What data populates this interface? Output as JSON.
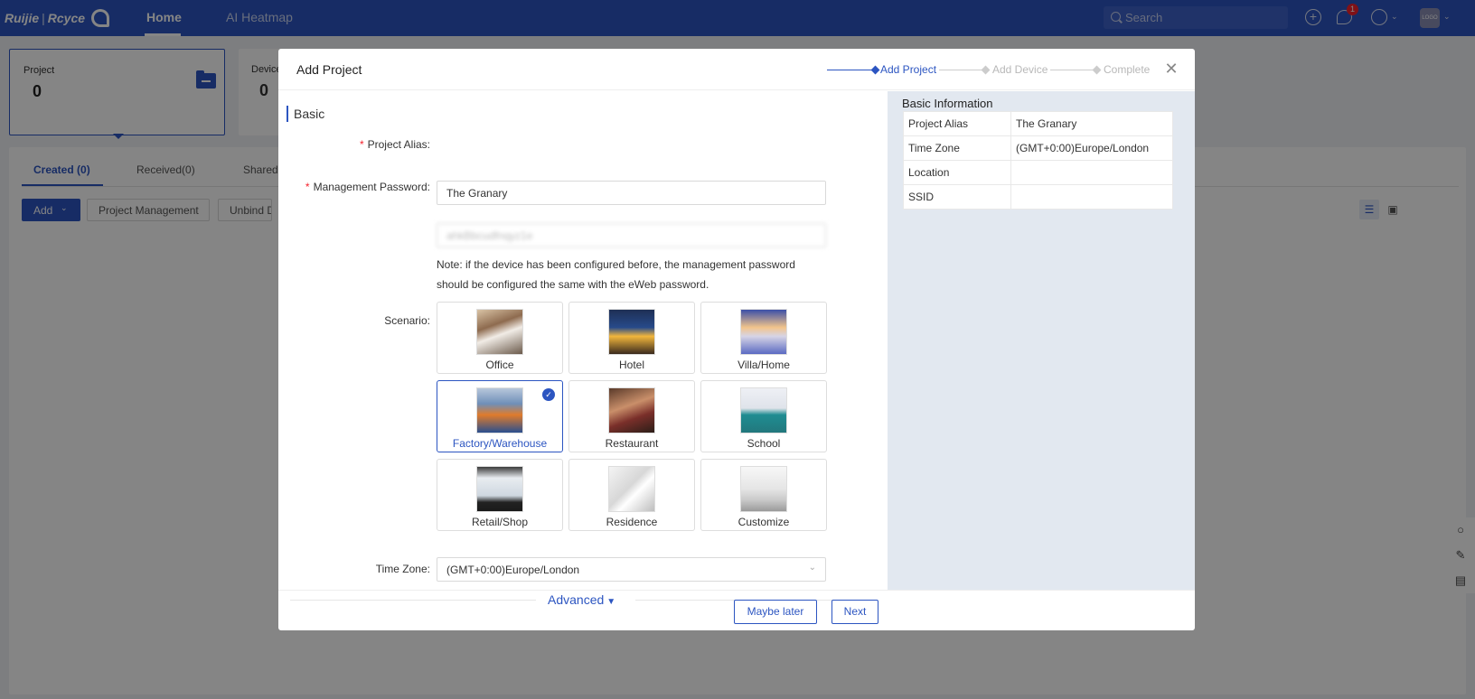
{
  "topbar": {
    "brand": "Ruijie",
    "brand_sep": "|",
    "brand_product": "Rcyce",
    "nav_home": "Home",
    "nav_heatmap": "AI Heatmap",
    "search_placeholder": "Search",
    "notification_count": "1",
    "avatar_text": "LOGO",
    "icons": [
      "plus-circle-icon",
      "chat-icon",
      "globe-icon",
      "chevron-down-icon"
    ],
    "accent_color": "#2c55c1"
  },
  "background": {
    "project_card_label": "Project",
    "project_card_value": "0",
    "device_card_label": "Device",
    "device_card_value": "0",
    "tabs": [
      "Created (0)",
      "Received(0)",
      "Shared"
    ],
    "btn_add": "Add",
    "btn_project_management": "Project Management",
    "btn_unbind": "Unbind De"
  },
  "modal": {
    "title": "Add Project",
    "steps": [
      "Add Project",
      "Add Device",
      "Complete"
    ],
    "active_step": 0,
    "section_title": "Basic",
    "project_alias_label": "Project Alias",
    "project_alias_value": "The Granary",
    "password_label": "Management Password",
    "password_value": "ahkBbcudfnqyz1e",
    "note_line1": "Note: if the device has been configured before, the management password",
    "note_line2": "should be configured the same with the eWeb password.",
    "scenario_label": "Scenario",
    "scenarios": [
      "Office",
      "Hotel",
      "Villa/Home",
      "Factory/Warehouse",
      "Restaurant",
      "School",
      "Retail/Shop",
      "Residence",
      "Customize"
    ],
    "selected_scenario": "Factory/Warehouse",
    "timezone_label": "Time Zone",
    "timezone_value": "(GMT+0:00)Europe/London",
    "advanced_label": "Advanced",
    "btn_maybe_later": "Maybe later",
    "btn_next": "Next"
  },
  "info_panel": {
    "title": "Basic Information",
    "rows": [
      {
        "key": "Project Alias",
        "value": "The Granary"
      },
      {
        "key": "Time Zone",
        "value": "(GMT+0:00)Europe/London"
      },
      {
        "key": "Location",
        "value": ""
      },
      {
        "key": "SSID",
        "value": ""
      }
    ]
  }
}
